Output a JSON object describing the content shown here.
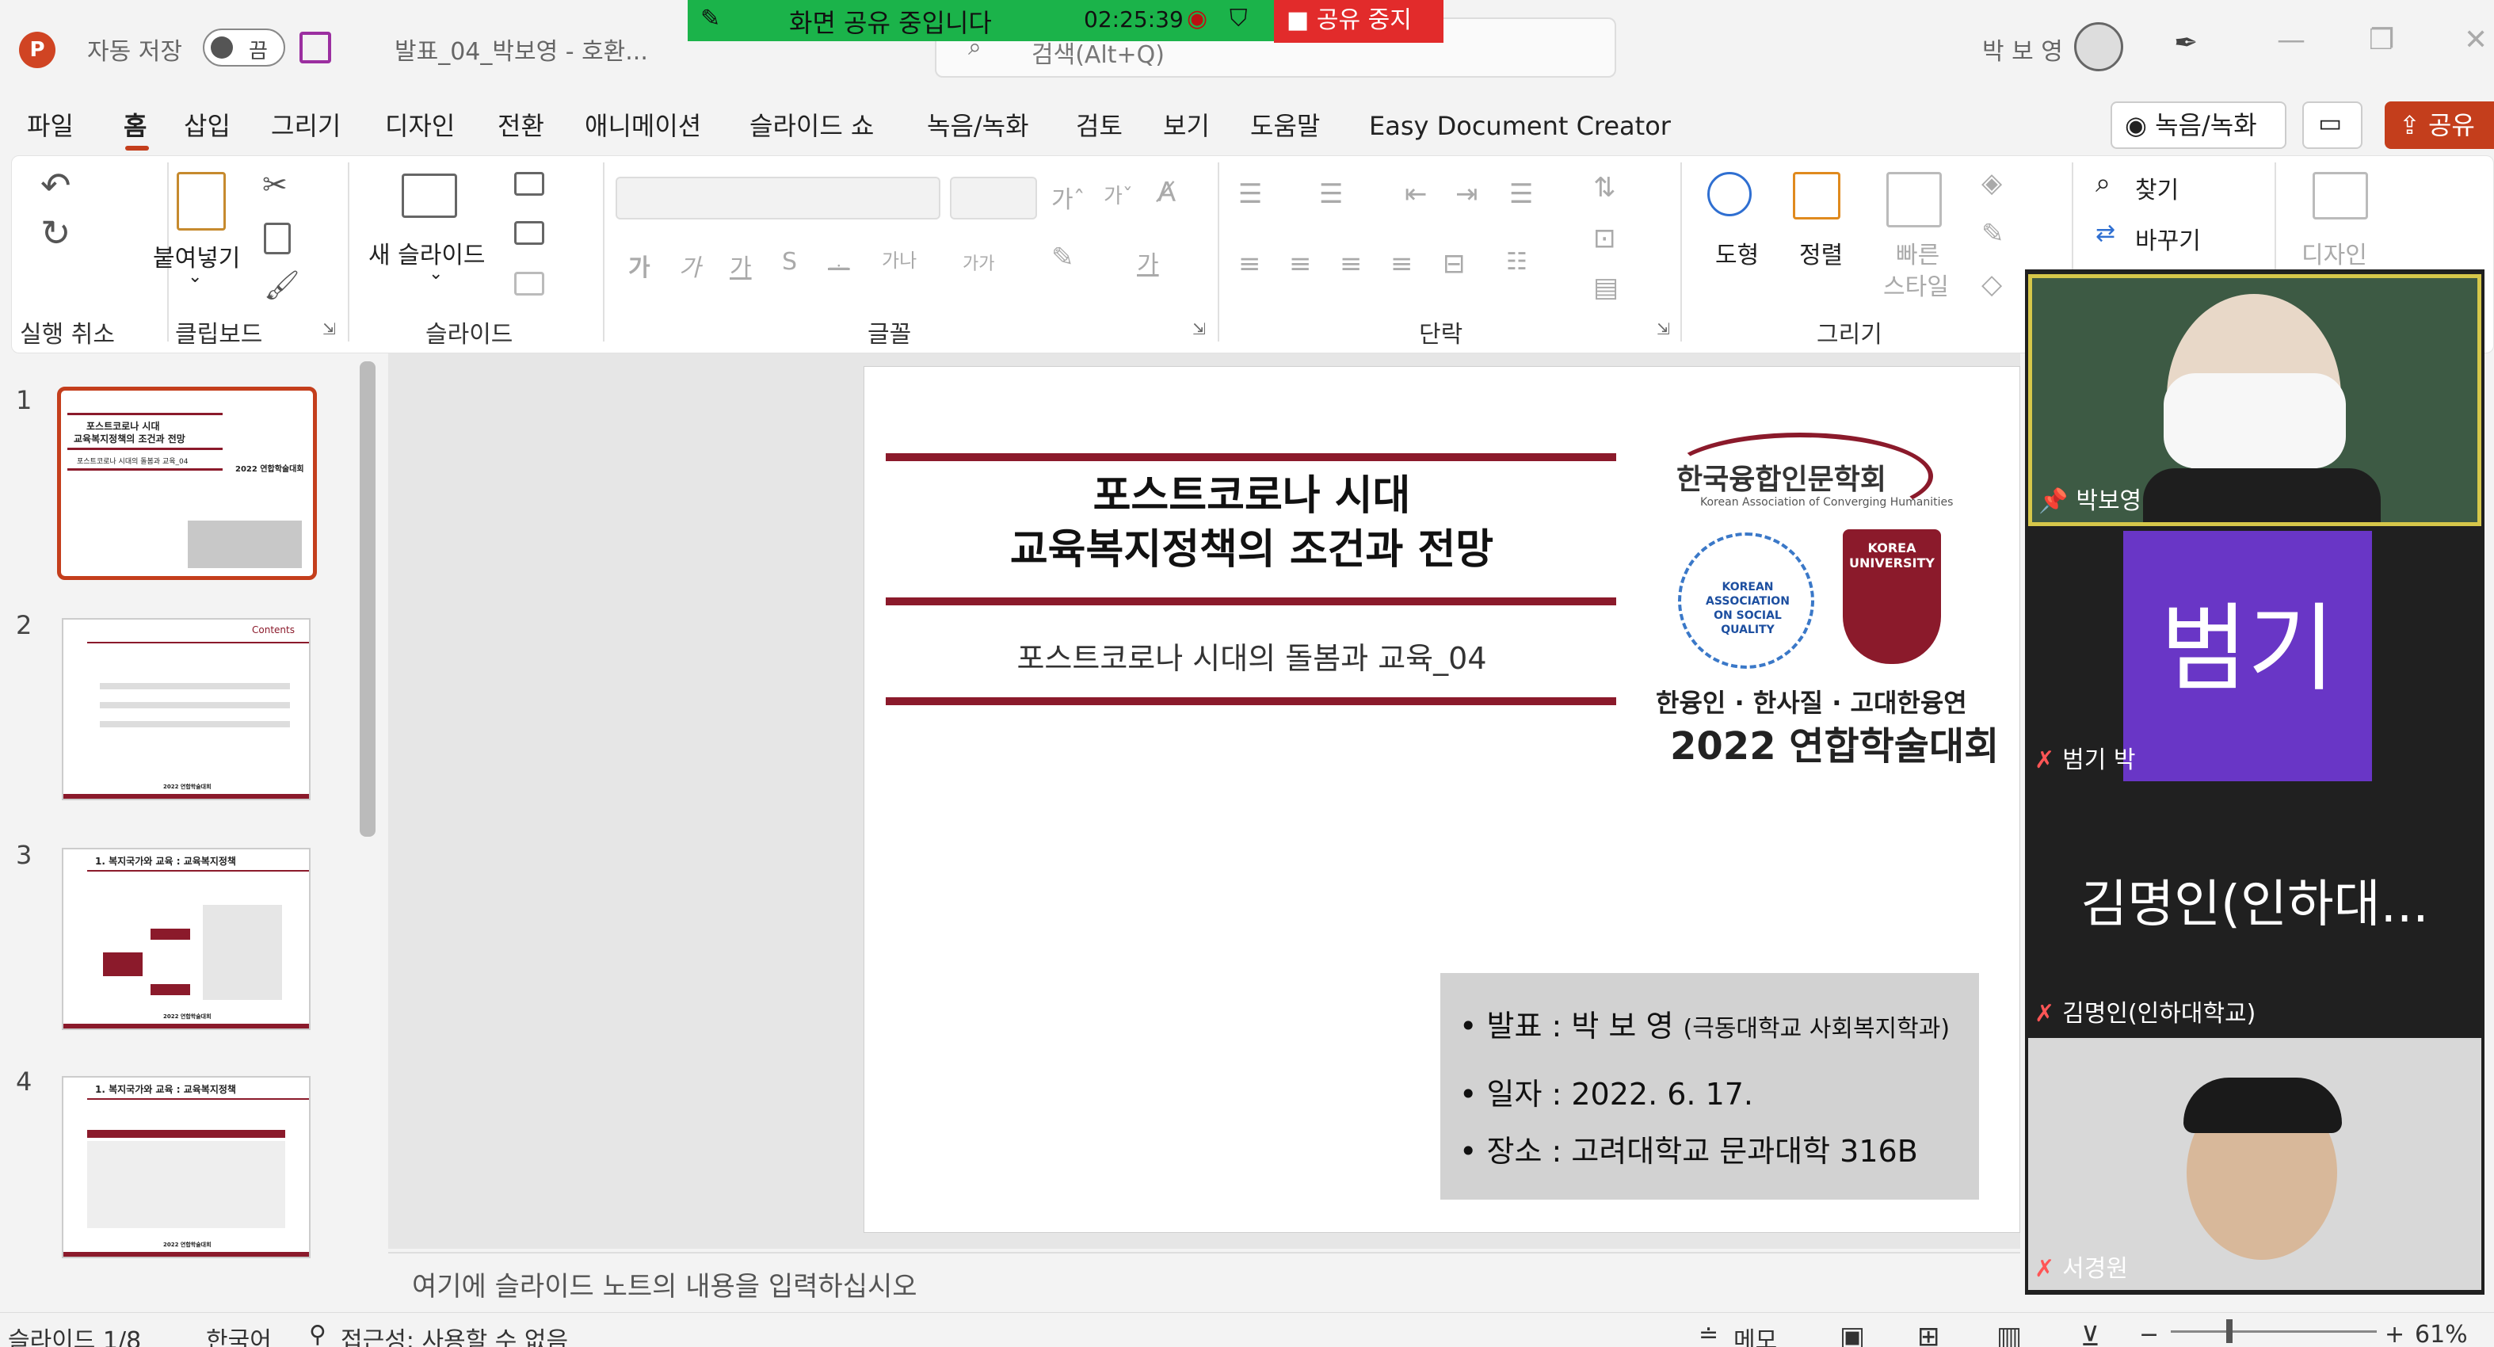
{
  "window": {
    "autosave_label": "자동 저장",
    "autosave_state": "끔",
    "file_title": "발표_04_박보영 - 호환...",
    "search_placeholder": "검색(Alt+Q)",
    "user_name": "박 보 영"
  },
  "share_banner": {
    "text": "화면 공유 중입니다",
    "time": "02:25:39",
    "stop_label": "공유 중지"
  },
  "menu": [
    "파일",
    "홈",
    "삽입",
    "그리기",
    "디자인",
    "전환",
    "애니메이션",
    "슬라이드 쇼",
    "녹음/녹화",
    "검토",
    "보기",
    "도움말",
    "Easy Document Creator"
  ],
  "menu_right": {
    "record": "녹음/녹화",
    "share": "공유"
  },
  "ribbon": {
    "groups": [
      "실행 취소",
      "클립보드",
      "슬라이드",
      "글꼴",
      "단락",
      "그리기"
    ],
    "paste": "붙여넣기",
    "new_slide": "새 슬라이드",
    "shape": "도형",
    "arrange": "정렬",
    "quick_style_1": "빠른",
    "quick_style_2": "스타일",
    "find": "찾기",
    "replace": "바꾸기",
    "designer": "디자인",
    "font_glyphs": [
      "가",
      "가",
      "가",
      "S",
      "ᆠ",
      "가나",
      "가가",
      "가"
    ]
  },
  "thumbnails": [
    {
      "num": "1",
      "title1": "포스트코로나 시대",
      "title2": "교육복지정책의 조건과 전망",
      "sub": "포스트코로나 시대의 돌봄과 교육_04",
      "org": "2022 연합학술대회"
    },
    {
      "num": "2",
      "title": "Contents",
      "footer": "2022 연합학술대회"
    },
    {
      "num": "3",
      "title": "1. 복지국가와 교육 : 교육복지정책",
      "footer": "2022 연합학술대회"
    },
    {
      "num": "4",
      "title": "1. 복지국가와 교육 : 교육복지정책",
      "footer": "2022 연합학술대회"
    }
  ],
  "slide": {
    "title_line1": "포스트코로나 시대",
    "title_line2": "교육복지정책의 조건과 전망",
    "subtitle": "포스트코로나 시대의 돌봄과 교육_04",
    "org_name_ko": "한국융합인문학회",
    "org_name_en": "Korean Association of Converging Humanities",
    "kasq_text": "KOREAN ASSOCIATION ON SOCIAL QUALITY",
    "korea_univ": "KOREA UNIVERSITY",
    "conference_line1": "한융인 · 한사질 · 고대한융연",
    "conference_line2": "2022 연합학술대회",
    "presenter_label": "• 발표 : 박 보 영",
    "presenter_affil": "(극동대학교 사회복지학과)",
    "date_line": "• 일자 : 2022. 6. 17.",
    "place_line": "• 장소 : 고려대학교 문과대학 316B"
  },
  "notes_placeholder": "여기에 슬라이드 노트의 내용을 입력하십시오",
  "status": {
    "slide_counter": "슬라이드 1/8",
    "language": "한국어",
    "accessibility": "접근성: 사용할 수 없음",
    "notes_btn": "메모",
    "zoom": "61%"
  },
  "participants": [
    {
      "name": "박보영",
      "muted": false
    },
    {
      "name": "범기 박",
      "initials": "범기",
      "muted": true
    },
    {
      "name": "김명인(인하대학교)",
      "display": "김명인(인하대...",
      "muted": true
    },
    {
      "name": "서경원",
      "muted": true
    }
  ],
  "colors": {
    "accent": "#c43e1c",
    "slide_maroon": "#8b1a2b",
    "share_green": "#1bb34a",
    "stop_red": "#e22b2b",
    "avatar_purple": "#6936c6"
  }
}
